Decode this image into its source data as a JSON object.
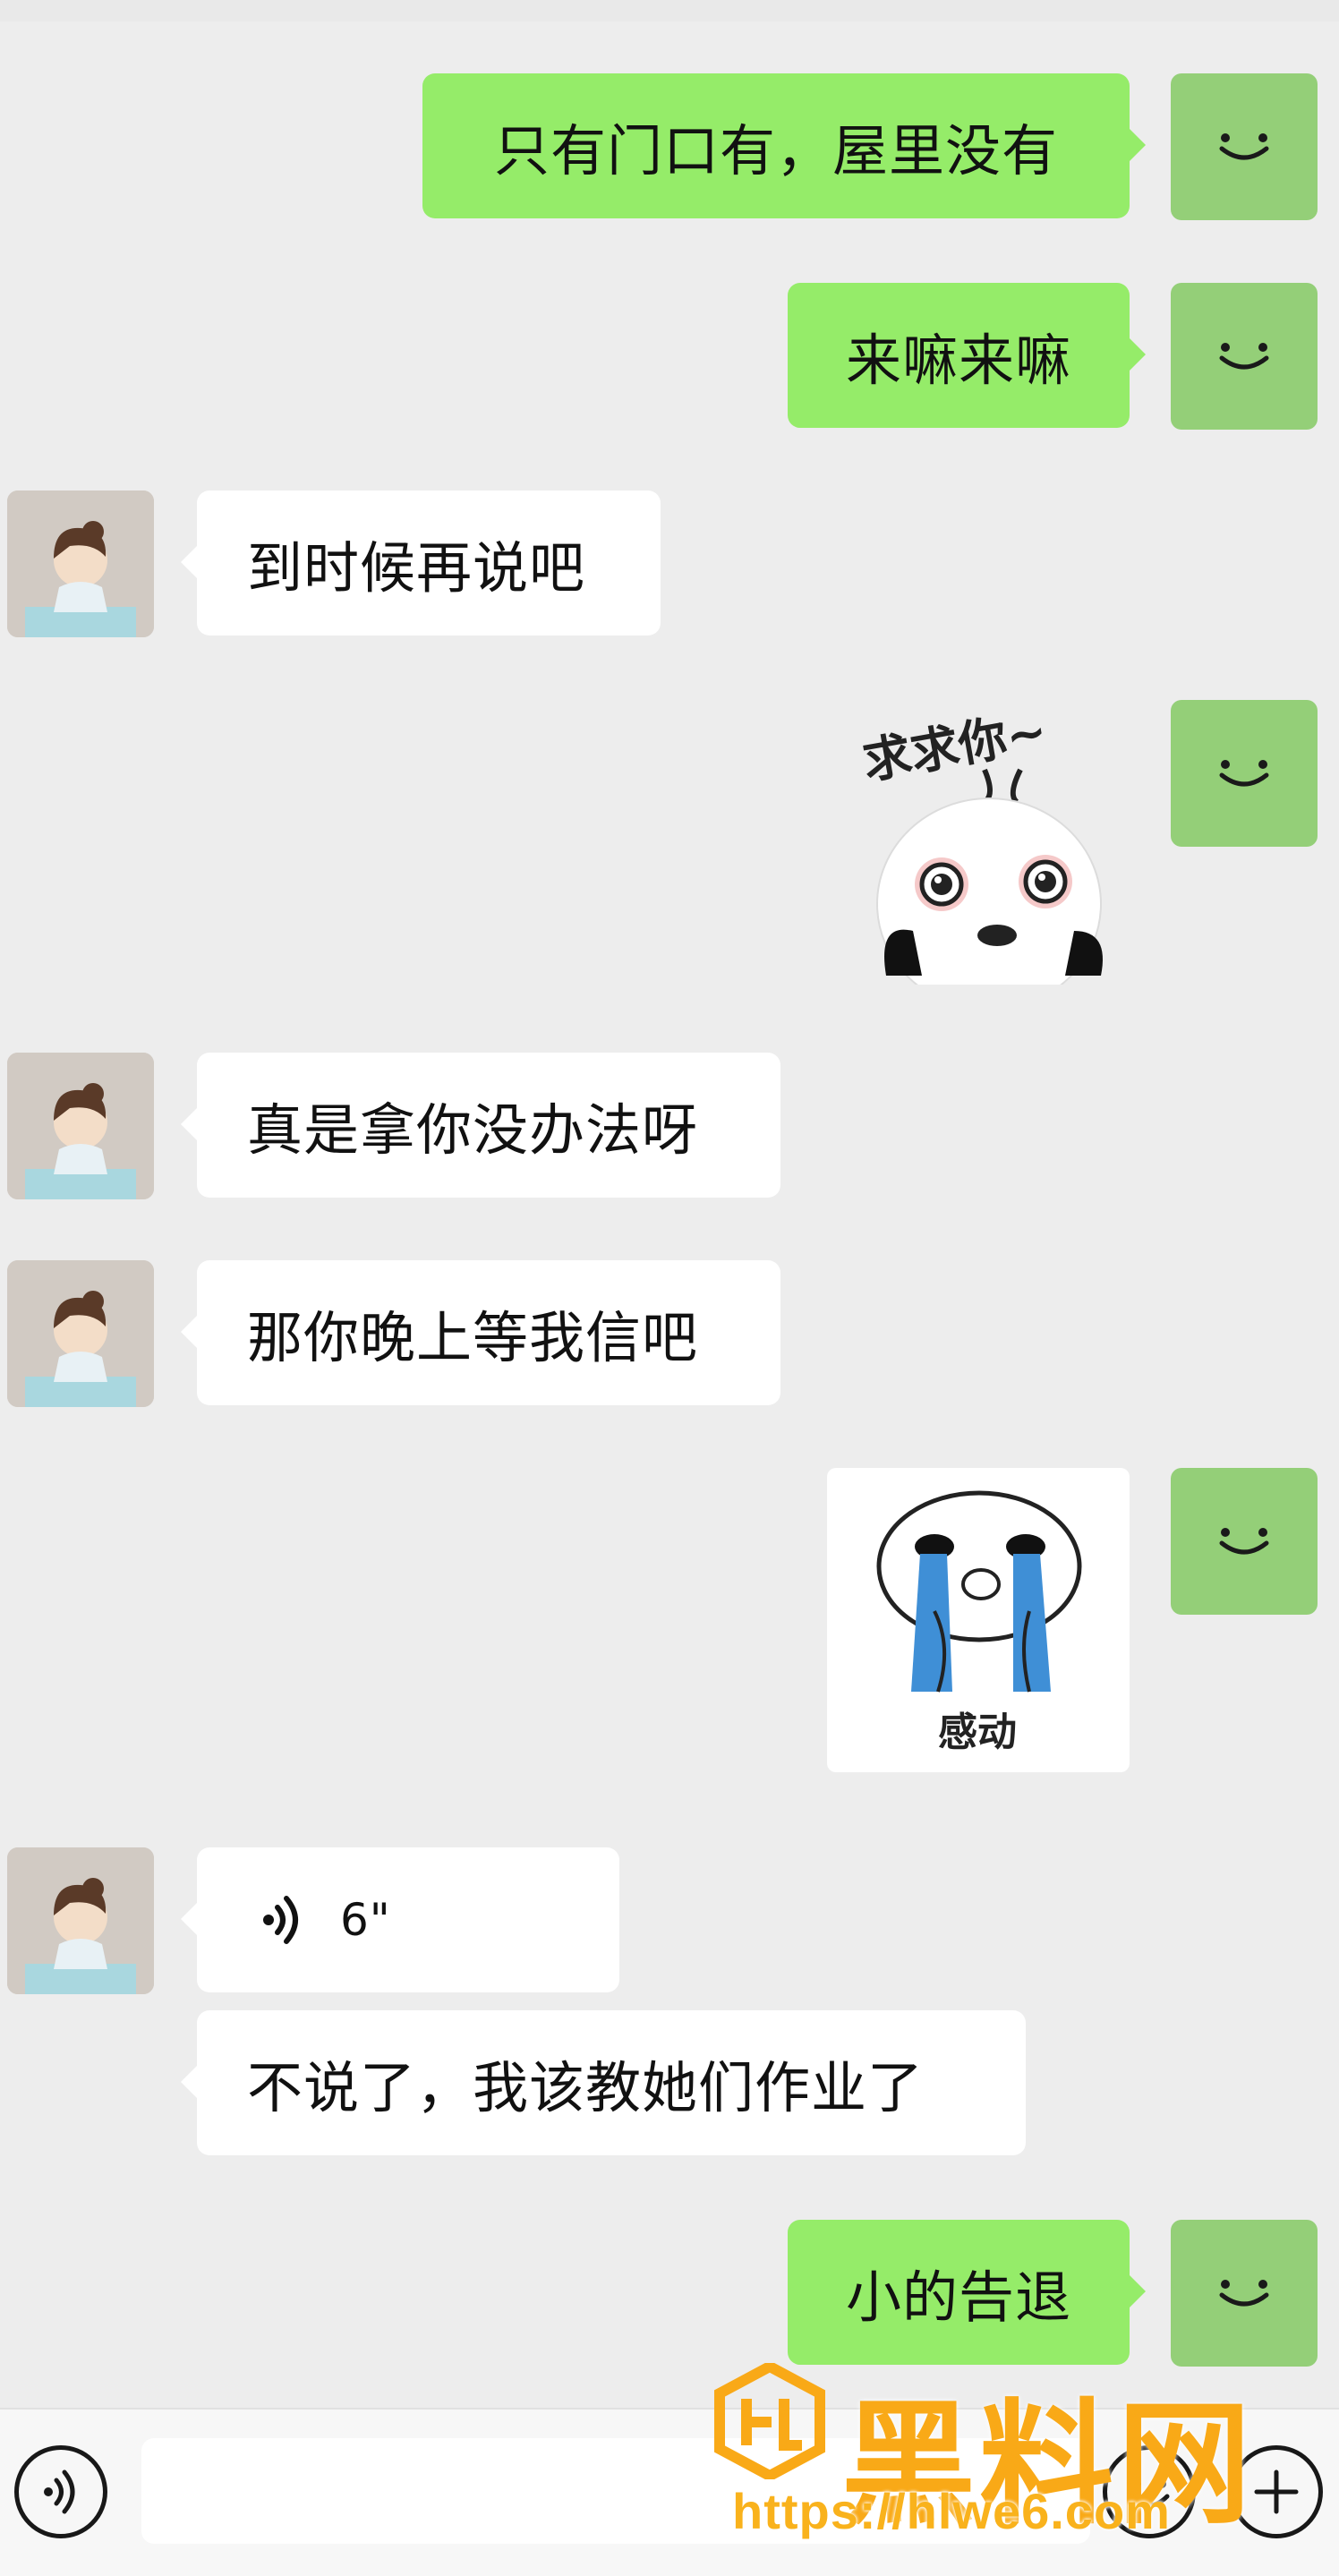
{
  "messages": [
    {
      "side": "out",
      "type": "text",
      "text": "只有门口有，屋里没有"
    },
    {
      "side": "out",
      "type": "text",
      "text": "来嘛来嘛"
    },
    {
      "side": "in",
      "type": "text",
      "text": "到时候再说吧"
    },
    {
      "side": "out",
      "type": "sticker",
      "sticker_text": "求求你~"
    },
    {
      "side": "in",
      "type": "text",
      "text": "真是拿你没办法呀"
    },
    {
      "side": "in",
      "type": "text",
      "text": "那你晚上等我信吧"
    },
    {
      "side": "out",
      "type": "sticker",
      "sticker_text": "感动"
    },
    {
      "side": "in",
      "type": "voice",
      "duration": "6\""
    },
    {
      "side": "in",
      "type": "text",
      "text": "不说了，我该教她们作业了"
    },
    {
      "side": "out",
      "type": "text",
      "text": "小的告退"
    }
  ],
  "bottom_bar": {
    "voice_icon": "voice-toggle-icon",
    "emoji_icon": "emoji-icon",
    "plus_icon": "plus-icon"
  },
  "watermark": {
    "title": "黑料网",
    "url": "https://hlwe6.com"
  },
  "colors": {
    "outgoing_bubble": "#95ec69",
    "incoming_bubble": "#ffffff",
    "self_avatar": "#94cf78",
    "background": "#ededed",
    "watermark": "#f9a917"
  }
}
